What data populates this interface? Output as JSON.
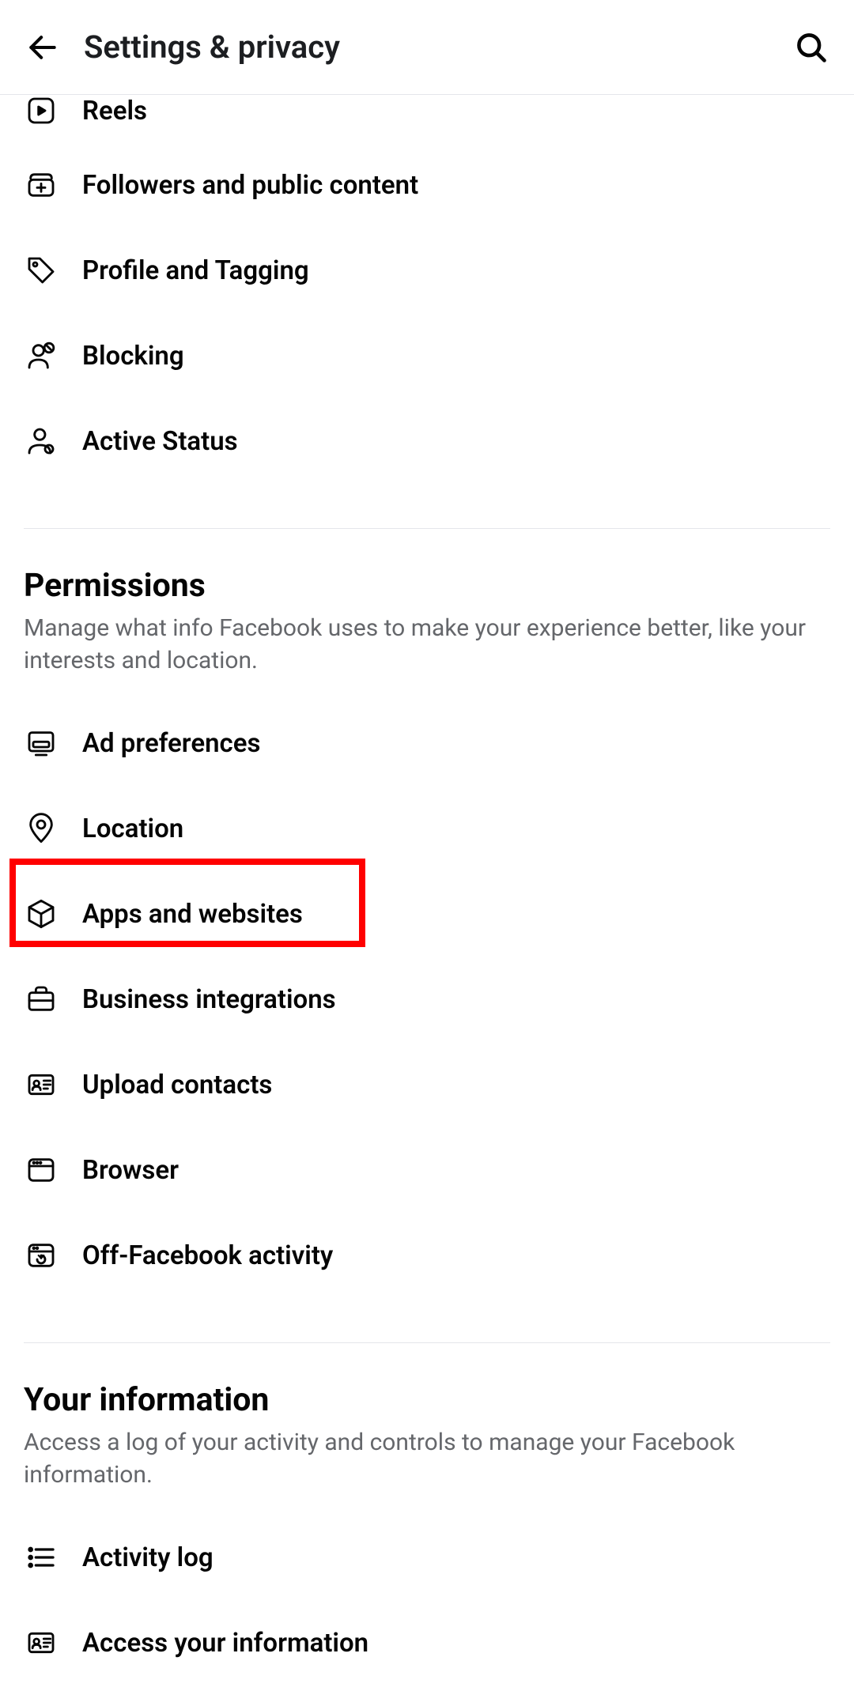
{
  "header": {
    "title": "Settings & privacy"
  },
  "audience_section": {
    "items": [
      {
        "icon": "reels-icon",
        "label": "Reels"
      },
      {
        "icon": "followers-icon",
        "label": "Followers and public content"
      },
      {
        "icon": "tag-icon",
        "label": "Profile and Tagging"
      },
      {
        "icon": "blocking-icon",
        "label": "Blocking"
      },
      {
        "icon": "active-status-icon",
        "label": "Active Status"
      }
    ]
  },
  "permissions_section": {
    "title": "Permissions",
    "description": "Manage what info Facebook uses to make your experience better, like your interests and location.",
    "items": [
      {
        "icon": "ad-icon",
        "label": "Ad preferences"
      },
      {
        "icon": "location-icon",
        "label": "Location"
      },
      {
        "icon": "cube-icon",
        "label": "Apps and websites",
        "highlighted": true
      },
      {
        "icon": "briefcase-icon",
        "label": "Business integrations"
      },
      {
        "icon": "contacts-icon",
        "label": "Upload contacts"
      },
      {
        "icon": "browser-icon",
        "label": "Browser"
      },
      {
        "icon": "off-facebook-icon",
        "label": "Off-Facebook activity"
      }
    ]
  },
  "your_information_section": {
    "title": "Your information",
    "description": "Access a log of your activity and controls to manage your Facebook information.",
    "items": [
      {
        "icon": "activity-log-icon",
        "label": "Activity log"
      },
      {
        "icon": "access-info-icon",
        "label": "Access your information"
      }
    ]
  }
}
